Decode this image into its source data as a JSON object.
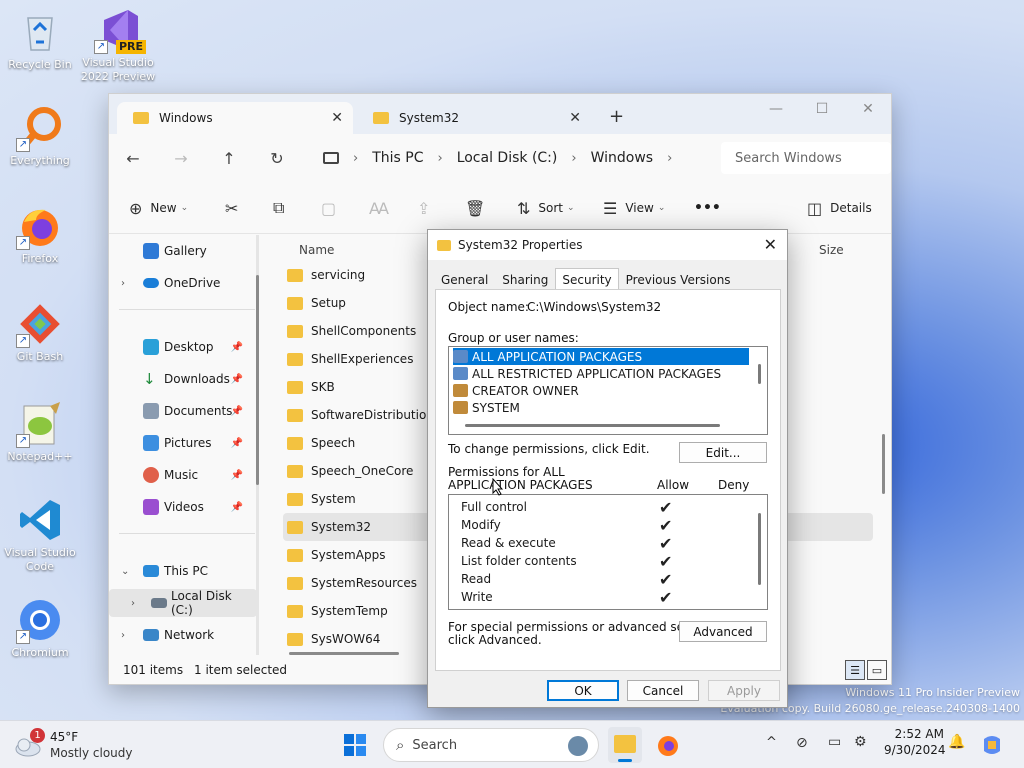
{
  "desktop": {
    "icons": [
      {
        "label_1": "Recycle Bin",
        "label_2": ""
      },
      {
        "label_1": "Visual Studio",
        "label_2": "2022 Preview",
        "badge": "PRE"
      },
      {
        "label_1": "Everything",
        "label_2": ""
      },
      {
        "label_1": "Firefox",
        "label_2": ""
      },
      {
        "label_1": "Git Bash",
        "label_2": ""
      },
      {
        "label_1": "Notepad++",
        "label_2": ""
      },
      {
        "label_1": "Visual Studio",
        "label_2": "Code"
      },
      {
        "label_1": "Chromium",
        "label_2": ""
      }
    ],
    "watermark": {
      "line1": "Windows 11 Pro Insider Preview",
      "line2": "Evaluation copy. Build 26080.ge_release.240308-1400"
    }
  },
  "explorer": {
    "tabs": [
      {
        "label": "Windows",
        "active": true
      },
      {
        "label": "System32",
        "active": false
      }
    ],
    "new_tab": "+",
    "controls": {
      "minimize": "—",
      "maximize": "☐",
      "close": "✕"
    },
    "nav": {
      "back": "←",
      "forward": "→",
      "up": "↑",
      "refresh": "↻"
    },
    "breadcrumb": [
      "This PC",
      "Local Disk (C:)",
      "Windows"
    ],
    "search_placeholder": "Search Windows",
    "toolbar": {
      "new_label": "New",
      "sort_label": "Sort",
      "view_label": "View",
      "more": "•••",
      "details_label": "Details"
    },
    "navpane": {
      "gallery": "Gallery",
      "onedrive": "OneDrive",
      "quick": [
        "Desktop",
        "Downloads",
        "Documents",
        "Pictures",
        "Music",
        "Videos"
      ],
      "this_pc": "This PC",
      "local_disk": "Local Disk (C:)",
      "network": "Network"
    },
    "columns": {
      "name": "Name",
      "size": "Size"
    },
    "files": [
      "servicing",
      "Setup",
      "ShellComponents",
      "ShellExperiences",
      "SKB",
      "SoftwareDistribution",
      "Speech",
      "Speech_OneCore",
      "System",
      "System32",
      "SystemApps",
      "SystemResources",
      "SystemTemp",
      "SysWOW64"
    ],
    "selected_file": "System32",
    "status": {
      "count": "101 items",
      "selection": "1 item selected"
    }
  },
  "dialog": {
    "title": "System32 Properties",
    "close": "✕",
    "tabs": [
      "General",
      "Sharing",
      "Security",
      "Previous Versions"
    ],
    "active_tab": "Security",
    "object_name_label": "Object name:",
    "object_name_value": "C:\\Windows\\System32",
    "groups_label": "Group or user names:",
    "groups": [
      "ALL APPLICATION PACKAGES",
      "ALL RESTRICTED APPLICATION PACKAGES",
      "CREATOR OWNER",
      "SYSTEM"
    ],
    "change_hint": "To change permissions, click Edit.",
    "edit_button": "Edit...",
    "perm_label_1": "Permissions for ALL",
    "perm_label_2": "APPLICATION PACKAGES",
    "allow_label": "Allow",
    "deny_label": "Deny",
    "permissions": [
      {
        "name": "Full control",
        "allow": true
      },
      {
        "name": "Modify",
        "allow": true
      },
      {
        "name": "Read & execute",
        "allow": true
      },
      {
        "name": "List folder contents",
        "allow": true
      },
      {
        "name": "Read",
        "allow": true
      },
      {
        "name": "Write",
        "allow": true
      }
    ],
    "advanced_hint_1": "For special permissions or advanced settings,",
    "advanced_hint_2": "click Advanced.",
    "advanced_button": "Advanced",
    "ok_button": "OK",
    "cancel_button": "Cancel",
    "apply_button": "Apply"
  },
  "taskbar": {
    "weather_temp": "45°F",
    "weather_desc": "Mostly cloudy",
    "weather_badge": "1",
    "search_label": "Search",
    "time": "2:52 AM",
    "date": "9/30/2024",
    "chevron": "^",
    "colors": {
      "accent": "#0078d7",
      "folder": "#f3c240"
    }
  }
}
